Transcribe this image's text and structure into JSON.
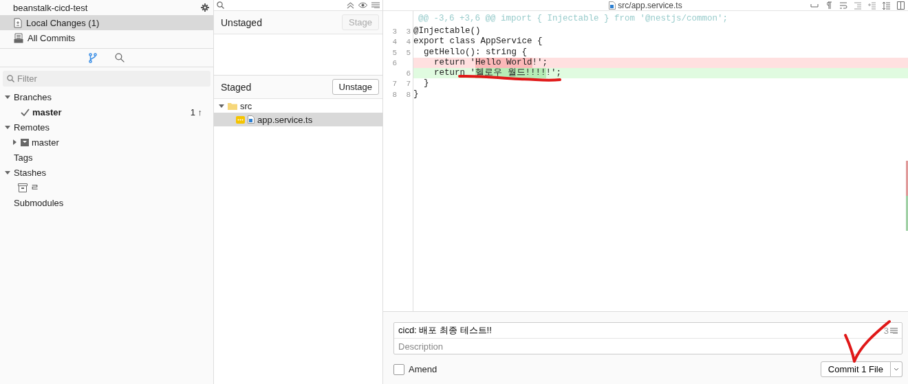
{
  "sidebar": {
    "repo_title": "beanstalk-cicd-test",
    "nav_items": [
      {
        "label": "Local Changes (1)",
        "kind": "changes",
        "selected": true
      },
      {
        "label": "All Commits",
        "kind": "commits",
        "selected": false
      }
    ],
    "view_tabs": [
      {
        "kind": "branches",
        "selected": true
      },
      {
        "kind": "search",
        "selected": false
      }
    ],
    "filter": {
      "placeholder": "Filter"
    },
    "tree": [
      {
        "label": "Branches",
        "expanded": true,
        "children": [
          {
            "label": "master",
            "kind": "branch",
            "current": true,
            "badge": "1 ↑"
          }
        ]
      },
      {
        "label": "Remotes",
        "expanded": true,
        "children": [
          {
            "label": "master",
            "kind": "remote",
            "expanded": false
          }
        ]
      },
      {
        "label": "Tags"
      },
      {
        "label": "Stashes",
        "expanded": true,
        "children": [
          {
            "label": "ㄹ",
            "kind": "stash"
          }
        ]
      },
      {
        "label": "Submodules"
      }
    ]
  },
  "changes": {
    "unstaged": {
      "title": "Unstaged",
      "button": {
        "label": "Stage",
        "disabled": true
      }
    },
    "staged": {
      "title": "Staged",
      "button": {
        "label": "Unstage",
        "disabled": false
      },
      "tree": [
        {
          "label": "src",
          "kind": "folder",
          "expanded": true,
          "selected": false,
          "children": [
            {
              "label": "app.service.ts",
              "kind": "file",
              "modified": true,
              "selected": true
            }
          ]
        }
      ]
    }
  },
  "diff": {
    "file": "src/app.service.ts",
    "hunk_header": "@@ -3,6 +3,6 @@ import { Injectable } from '@nestjs/common';",
    "lines": [
      {
        "kind": "context",
        "old": "3",
        "new": "3",
        "segments": [
          {
            "text": "@Injectable()",
            "changed": false
          }
        ]
      },
      {
        "kind": "context",
        "old": "4",
        "new": "4",
        "segments": [
          {
            "text": "export class AppService {",
            "changed": false
          }
        ]
      },
      {
        "kind": "context",
        "old": "5",
        "new": "5",
        "segments": [
          {
            "text": "  getHello(): string {",
            "changed": false
          }
        ]
      },
      {
        "kind": "removed",
        "old": "6",
        "segments": [
          {
            "text": "    return '",
            "changed": false
          },
          {
            "text": "Hello World",
            "changed": true
          },
          {
            "text": "!';",
            "changed": false
          }
        ]
      },
      {
        "kind": "added",
        "new": "6",
        "segments": [
          {
            "text": "    return '",
            "changed": false
          },
          {
            "text": "헬로우 월드!!!!",
            "changed": true
          },
          {
            "text": "!';",
            "changed": false
          }
        ]
      },
      {
        "kind": "context",
        "old": "7",
        "new": "7",
        "segments": [
          {
            "text": "  }",
            "changed": false
          }
        ]
      },
      {
        "kind": "context",
        "old": "8",
        "new": "8",
        "segments": [
          {
            "text": "}",
            "changed": false
          }
        ]
      }
    ]
  },
  "commit": {
    "message": "cicd: 배포 최종 테스트!!",
    "char_count": "3",
    "description_placeholder": "Description",
    "amend": {
      "label": "Amend",
      "checked": false
    },
    "button": "Commit 1 File"
  }
}
